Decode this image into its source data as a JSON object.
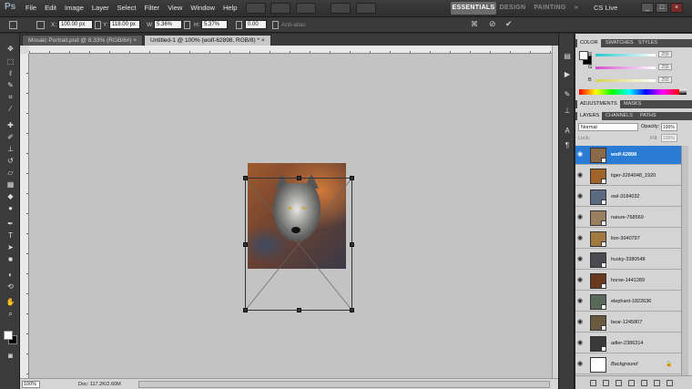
{
  "app": {
    "logo": "Ps"
  },
  "menu": [
    "File",
    "Edit",
    "Image",
    "Layer",
    "Select",
    "Filter",
    "View",
    "Window",
    "Help"
  ],
  "workspaces": {
    "essentials": "ESSENTIALS",
    "design": "DESIGN",
    "painting": "PAINTING",
    "more": "»"
  },
  "cs_live": "CS Live",
  "options": {
    "x_label": "X:",
    "x_value": "100.00 px",
    "y_label": "Y:",
    "y_value": "118.00 px",
    "w_label": "W:",
    "w_value": "5.36%",
    "h_label": "H:",
    "h_value": "5.37%",
    "angle_value": "0.00",
    "antialias_label": "Anti-alias"
  },
  "tabs": [
    {
      "label": "Mosaic Portrait.psd @ 8.33% (RGB/8#)",
      "close": "×"
    },
    {
      "label": "Untitled-1 @ 100% (wolf-62898, RGB/8) *",
      "close": "×"
    }
  ],
  "status": {
    "zoom": "100%",
    "doc": "Doc: 117.2K/2.60M"
  },
  "panels": {
    "color_tabs": [
      "COLOR",
      "SWATCHES",
      "STYLES"
    ],
    "sliders": [
      {
        "label": "R",
        "value": "255",
        "color": "#27c7d0"
      },
      {
        "label": "G",
        "value": "255",
        "color": "#d64fd0"
      },
      {
        "label": "B",
        "value": "255",
        "color": "#d6d14f"
      }
    ],
    "adjust_tabs": [
      "ADJUSTMENTS",
      "MASKS"
    ],
    "layer_tabs": [
      "LAYERS",
      "CHANNELS",
      "PATHS"
    ],
    "blend_mode": "Normal",
    "opacity_label": "Opacity:",
    "opacity_value": "100%",
    "lock_label": "Lock:",
    "fill_label": "Fill:",
    "fill_value": "100%"
  },
  "layers": [
    {
      "name": "wolf-62898",
      "selected": true,
      "thumb": "#8a6a4a"
    },
    {
      "name": "tiger-3264048_1920",
      "selected": false,
      "thumb": "#a0632a"
    },
    {
      "name": "owl-3184032",
      "selected": false,
      "thumb": "#5a6a80"
    },
    {
      "name": "nature-768569",
      "selected": false,
      "thumb": "#9a8060"
    },
    {
      "name": "lion-3040797",
      "selected": false,
      "thumb": "#a07a40"
    },
    {
      "name": "husky-3380548",
      "selected": false,
      "thumb": "#4a4a50"
    },
    {
      "name": "horse-1441289",
      "selected": false,
      "thumb": "#6a3a20"
    },
    {
      "name": "elephant-1822636",
      "selected": false,
      "thumb": "#5a6a5a"
    },
    {
      "name": "bear-1245807",
      "selected": false,
      "thumb": "#6a5a40"
    },
    {
      "name": "adler-2386314",
      "selected": false,
      "thumb": "#3a3a3a"
    },
    {
      "name": "Background",
      "selected": false,
      "thumb": "#ffffff",
      "italic": true,
      "locked": true
    }
  ]
}
